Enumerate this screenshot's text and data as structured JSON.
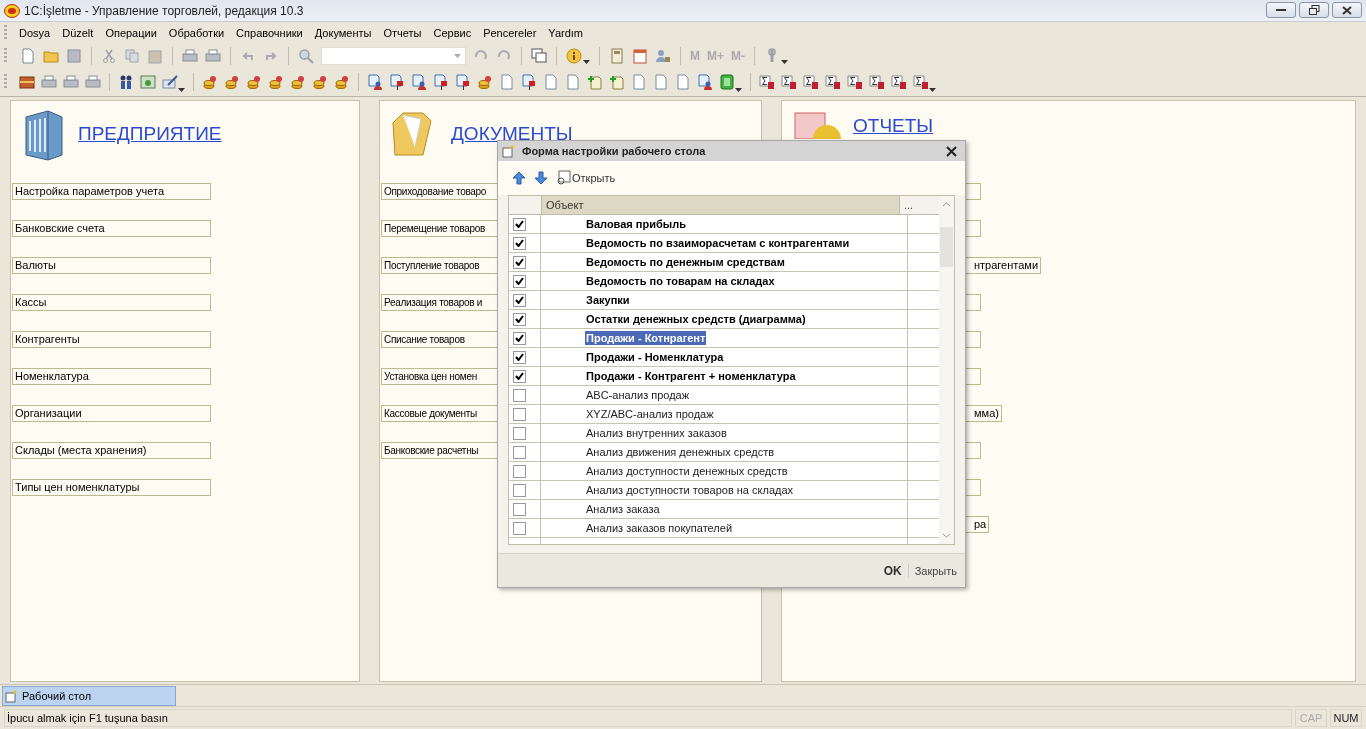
{
  "window": {
    "title": "1C:İşletme - Управление торговлей, редакция 10.3"
  },
  "menu": [
    "Dosya",
    "Düzelt",
    "Операции",
    "Обработки",
    "Справочники",
    "Документы",
    "Отчеты",
    "Сервис",
    "Pencereler",
    "Yardım"
  ],
  "toolbar": {
    "memory_buttons": [
      "M",
      "M+",
      "M-"
    ]
  },
  "panels": [
    {
      "title": "ПРЕДПРИЯТИЕ",
      "kind": "enterprise",
      "items": [
        "Настройка параметров учета",
        "Банковские счета",
        "Валюты",
        "Кассы",
        "Контрагенты",
        "Номенклатура",
        "Организации",
        "Склады (места хранения)",
        "Типы цен номенклатуры"
      ]
    },
    {
      "title": "ДОКУМЕНТЫ",
      "kind": "documents",
      "items": [
        "Оприходование товаро",
        "Перемещение товаров",
        "Поступление товаров",
        "Реализация товаров и",
        "Списание товаров",
        "Установка цен номен",
        "Кассовые документы",
        "Банковские расчетны"
      ]
    },
    {
      "title": "ОТЧЕТЫ",
      "kind": "reports",
      "items": [
        {
          "kind": "covered"
        },
        {
          "kind": "covered"
        },
        {
          "kind": "label",
          "label": "нтрагентами"
        },
        {
          "kind": "covered"
        },
        {
          "kind": "covered"
        },
        {
          "kind": "covered"
        },
        {
          "kind": "label",
          "label": "мма)"
        },
        {
          "kind": "covered"
        },
        {
          "kind": "covered"
        },
        {
          "kind": "label",
          "label": "ра"
        }
      ]
    }
  ],
  "dialog": {
    "title": "Форма настройки рабочего стола",
    "open_button": "Открыть",
    "columns": [
      "Объект",
      "..."
    ],
    "rows": [
      {
        "label": "Валовая прибыль",
        "checked": true,
        "selected": false
      },
      {
        "label": "Ведомость по взаиморасчетам с контрагентами",
        "checked": true,
        "selected": false
      },
      {
        "label": "Ведомость по денежным средствам",
        "checked": true,
        "selected": false
      },
      {
        "label": "Ведомость по товарам на складах",
        "checked": true,
        "selected": false
      },
      {
        "label": "Закупки",
        "checked": true,
        "selected": false
      },
      {
        "label": "Остатки денежных средств (диаграмма)",
        "checked": true,
        "selected": false
      },
      {
        "label": "Продажи - Котнрагент",
        "checked": true,
        "selected": true
      },
      {
        "label": "Продажи - Номенклатура",
        "checked": true,
        "selected": false
      },
      {
        "label": "Продажи - Контрагент + номенклатура",
        "checked": true,
        "selected": false
      },
      {
        "label": "ABC-анализ продаж",
        "checked": false,
        "selected": false
      },
      {
        "label": "XYZ/ABC-анализ продаж",
        "checked": false,
        "selected": false
      },
      {
        "label": "Анализ внутренних заказов",
        "checked": false,
        "selected": false
      },
      {
        "label": "Анализ движения денежных средств",
        "checked": false,
        "selected": false
      },
      {
        "label": "Анализ доступности денежных средств",
        "checked": false,
        "selected": false
      },
      {
        "label": "Анализ доступности товаров на складах",
        "checked": false,
        "selected": false
      },
      {
        "label": "Анализ заказа",
        "checked": false,
        "selected": false
      },
      {
        "label": "Анализ заказов покупателей",
        "checked": false,
        "selected": false
      }
    ],
    "ok_button": "OK",
    "close_button": "Закрыть"
  },
  "taskbar": [
    {
      "label": "Рабочий стол",
      "selected": true
    }
  ],
  "status_bar": {
    "hint": "İpucu almak için F1 tuşuna basın",
    "indicators": [
      {
        "label": "CAP",
        "on": false
      },
      {
        "label": "NUM",
        "on": true
      }
    ]
  }
}
